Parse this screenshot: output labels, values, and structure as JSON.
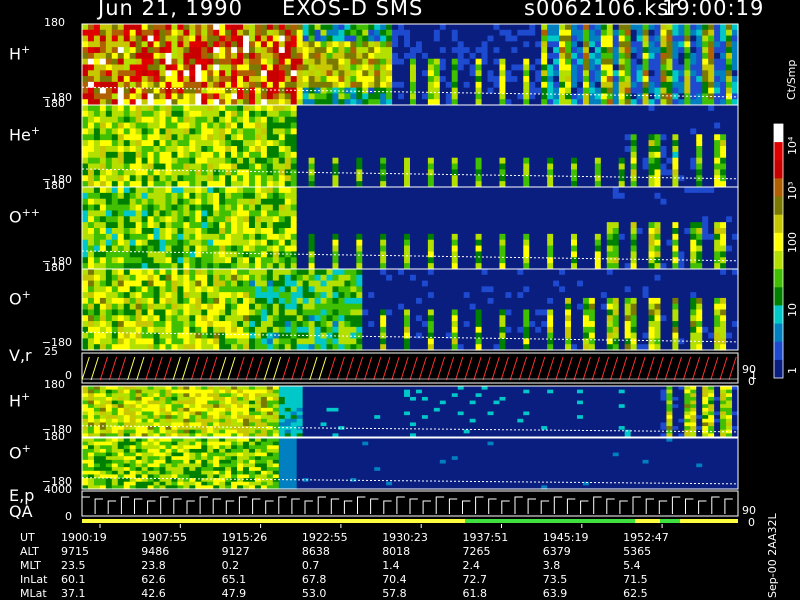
{
  "header": {
    "date": "Jun 21, 1990",
    "instrument": "EXOS-D SMS",
    "file": "s0062106.ksr",
    "time": "19:00:19"
  },
  "colorbar": {
    "unit": "Ct/Smp",
    "labels": [
      "10⁴",
      "10³",
      "100",
      "10",
      "1"
    ],
    "colors": [
      "#ffffff",
      "#e00000",
      "#c80000",
      "#b06000",
      "#7a7a00",
      "#c8c800",
      "#ffff00",
      "#b4e000",
      "#40c000",
      "#008000",
      "#00c8c8",
      "#0080c0",
      "#1e4ad0",
      "#0a1e80"
    ]
  },
  "panels": [
    {
      "id": "h1",
      "label": "H",
      "sup": "+",
      "ymax": "180",
      "ymin": "−180"
    },
    {
      "id": "he",
      "label": "He",
      "sup": "+",
      "ymax": "180",
      "ymin": "−180"
    },
    {
      "id": "opp",
      "label": "O",
      "sup": "++",
      "ymax": "180",
      "ymin": "−180"
    },
    {
      "id": "o1",
      "label": "O",
      "sup": "+",
      "ymax": "180",
      "ymin": "−180"
    },
    {
      "id": "vr",
      "label": "V,r",
      "sup": "",
      "ymax": "25",
      "ymin": "0",
      "right_top": "90",
      "right_bot": "0"
    },
    {
      "id": "h2",
      "label": "H",
      "sup": "+",
      "ymax": "180",
      "ymin": "−180"
    },
    {
      "id": "o2",
      "label": "O",
      "sup": "+",
      "ymax": "180",
      "ymin": "−180"
    },
    {
      "id": "ep",
      "label": "E,p",
      "label2": "QA",
      "ymax": "4000",
      "ymin": "0",
      "right_top": "90",
      "right_bot": "0"
    }
  ],
  "chart_data": {
    "type": "heatmap",
    "title": "Jun 21, 1990   EXOS-D SMS",
    "colorbar_label": "Ct/Smp",
    "x": {
      "UT": [
        "1900:19",
        "1907:55",
        "1915:26",
        "1922:55",
        "1930:23",
        "1937:51",
        "1945:19",
        "1952:47"
      ],
      "ALT": [
        "9715",
        "9486",
        "9127",
        "8638",
        "8018",
        "7265",
        "6379",
        "5365"
      ],
      "MLT": [
        "23.5",
        "23.8",
        "0.2",
        "0.7",
        "1.4",
        "2.4",
        "3.8",
        "5.4"
      ],
      "InLat": [
        "60.1",
        "62.6",
        "65.1",
        "67.8",
        "70.4",
        "72.7",
        "73.5",
        "71.5"
      ],
      "MLat": [
        "37.1",
        "42.6",
        "47.9",
        "53.0",
        "57.8",
        "61.8",
        "63.9",
        "62.5"
      ]
    },
    "row_labels": [
      "UT",
      "ALT",
      "MLT",
      "InLat",
      "MLat"
    ],
    "side_label": "Sep-00  2AA32L",
    "series": [
      {
        "name": "H+",
        "ylim": [
          -180,
          180
        ]
      },
      {
        "name": "He+",
        "ylim": [
          -180,
          180
        ]
      },
      {
        "name": "O++",
        "ylim": [
          -180,
          180
        ]
      },
      {
        "name": "O+",
        "ylim": [
          -180,
          180
        ]
      },
      {
        "name": "V,r",
        "ylim": [
          0,
          25
        ]
      },
      {
        "name": "H+",
        "ylim": [
          -180,
          180
        ]
      },
      {
        "name": "O+",
        "ylim": [
          -180,
          180
        ]
      },
      {
        "name": "E,p",
        "ylim": [
          0,
          4000
        ]
      }
    ]
  }
}
